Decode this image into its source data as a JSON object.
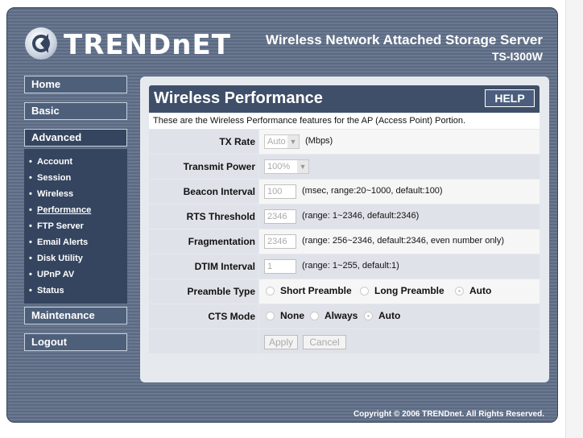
{
  "header": {
    "brand": "TRENDnET",
    "product_title": "Wireless Network Attached Storage Server",
    "model": "TS-I300W"
  },
  "nav": {
    "home": "Home",
    "basic": "Basic",
    "advanced": "Advanced",
    "advanced_items": [
      "Account",
      "Session",
      "Wireless",
      "Performance",
      "FTP Server",
      "Email Alerts",
      "Disk Utility",
      "UPnP AV",
      "Status"
    ],
    "maintenance": "Maintenance",
    "logout": "Logout"
  },
  "panel": {
    "title": "Wireless Performance",
    "help": "HELP",
    "description": "These are the Wireless Performance features for the AP (Access Point) Portion."
  },
  "form": {
    "tx_rate": {
      "label": "TX Rate",
      "value": "Auto",
      "unit": "(Mbps)"
    },
    "transmit_power": {
      "label": "Transmit Power",
      "value": "100%"
    },
    "beacon_interval": {
      "label": "Beacon Interval",
      "value": "100",
      "hint": "(msec, range:20~1000, default:100)"
    },
    "rts_threshold": {
      "label": "RTS Threshold",
      "value": "2346",
      "hint": "(range: 1~2346, default:2346)"
    },
    "fragmentation": {
      "label": "Fragmentation",
      "value": "2346",
      "hint": "(range: 256~2346, default:2346, even number only)"
    },
    "dtim_interval": {
      "label": "DTIM Interval",
      "value": "1",
      "hint": "(range: 1~255, default:1)"
    },
    "preamble_type": {
      "label": "Preamble Type",
      "options": [
        "Short Preamble",
        "Long Preamble",
        "Auto"
      ],
      "selected": "Auto"
    },
    "cts_mode": {
      "label": "CTS Mode",
      "options": [
        "None",
        "Always",
        "Auto"
      ],
      "selected": "Auto"
    },
    "apply": "Apply",
    "cancel": "Cancel"
  },
  "footer": {
    "copyright": "Copyright © 2006 TRENDnet. All Rights Reserved."
  },
  "colors": {
    "frame": "#5b6a82",
    "panel_header": "#3f4f69",
    "nav_active": "#35455f"
  }
}
